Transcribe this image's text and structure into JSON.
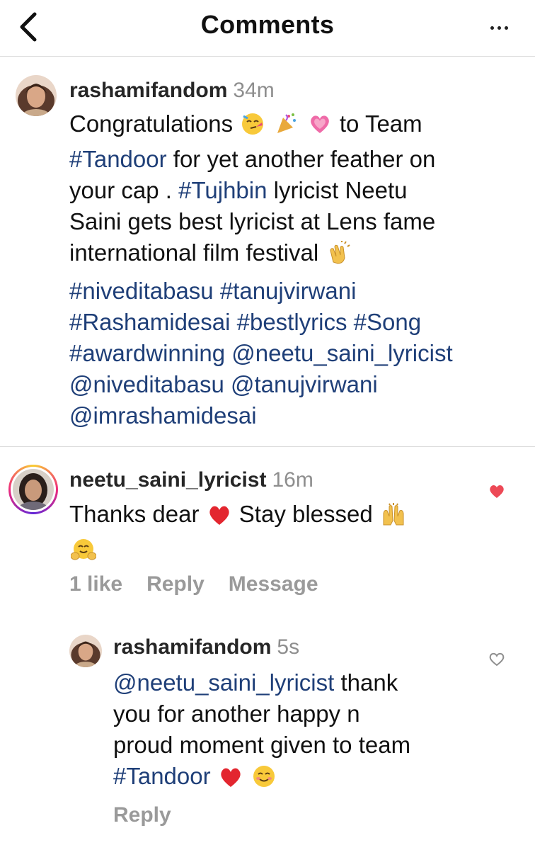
{
  "header": {
    "title": "Comments",
    "back_icon": "chevron-left-icon",
    "more_icon": "more-horizontal-icon"
  },
  "caption": {
    "username": "rashamifandom",
    "time": "34m",
    "text_1": "Congratulations",
    "text_2": "to Team",
    "tag_tandoor": "#Tandoor",
    "text_3": "for yet another feather on",
    "text_4": "your cap .",
    "tag_tujhbin": "#Tujhbin",
    "text_5": "lyricist Neetu",
    "text_6": "Saini gets best lyricist at Lens fame",
    "text_7": "international film festival",
    "hashtags_line1": "#niveditabasu #tanujvirwani",
    "hashtags_line2": "#Rashamidesai #bestlyrics  #Song",
    "hashtags_line3": "#awardwinning  @neetu_saini_lyricist",
    "hashtags_line4": "@niveditabasu @tanujvirwani",
    "hashtags_line5": "@imrashamidesai"
  },
  "comment": {
    "username": "neetu_saini_lyricist",
    "time": "16m",
    "text_1": "Thanks dear",
    "text_2": "Stay blessed",
    "likes": "1 like",
    "reply_label": "Reply",
    "message_label": "Message",
    "liked": true
  },
  "reply": {
    "username": "rashamifandom",
    "time": "5s",
    "mention": "@neetu_saini_lyricist",
    "text_1": "thank",
    "text_2": "you for another happy n",
    "text_3": "proud moment given to team",
    "tag": "#Tandoor",
    "reply_label": "Reply",
    "liked": false
  },
  "colors": {
    "link": "#1f3f78",
    "muted": "#8e8e8e",
    "heart_red": "#ed4956"
  }
}
